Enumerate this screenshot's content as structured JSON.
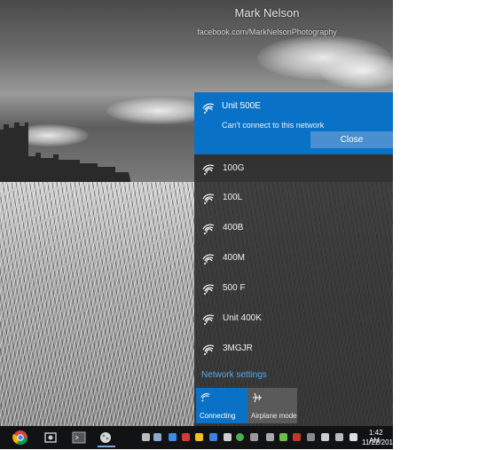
{
  "watermark": {
    "name": "Mark Nelson",
    "url": "facebook.com/MarkNelsonPhotography"
  },
  "network_flyout": {
    "active": {
      "name": "Unit 500E",
      "status": "Can't connect to this network",
      "close_label": "Close"
    },
    "networks": [
      {
        "name": "100G"
      },
      {
        "name": "100L"
      },
      {
        "name": "400B"
      },
      {
        "name": "400M"
      },
      {
        "name": "500 F"
      },
      {
        "name": "Unit 400K"
      },
      {
        "name": "3MGJR"
      }
    ],
    "settings_link": "Network settings",
    "tiles": {
      "connecting": "Connecting",
      "airplane": "Airplane mode"
    }
  },
  "taskbar": {
    "time": "1:42 AM",
    "date": "11/22/201"
  },
  "colors": {
    "accent": "#0a72c6",
    "link": "#55a8f0"
  }
}
